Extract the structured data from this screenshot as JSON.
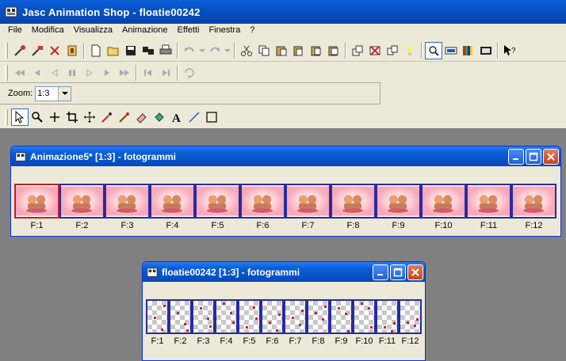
{
  "app": {
    "title": "Jasc Animation Shop - floatie00242"
  },
  "menu": [
    "File",
    "Modifica",
    "Visualizza",
    "Animazione",
    "Effetti",
    "Finestra",
    "?"
  ],
  "toolbar": {
    "zoom_label": "Zoom:",
    "zoom_value": "1:3"
  },
  "windows": {
    "animazione": {
      "title": "Animazione5* [1:3] - fotogrammi",
      "frames": [
        "F:1",
        "F:2",
        "F:3",
        "F:4",
        "F:5",
        "F:6",
        "F:7",
        "F:8",
        "F:9",
        "F:10",
        "F:11",
        "F:12"
      ]
    },
    "floatie": {
      "title": "floatie00242 [1:3] - fotogrammi",
      "frames": [
        "F:1",
        "F:2",
        "F:3",
        "F:4",
        "F:5",
        "F:6",
        "F:7",
        "F:8",
        "F:9",
        "F:10",
        "F:11",
        "F:12"
      ]
    }
  }
}
